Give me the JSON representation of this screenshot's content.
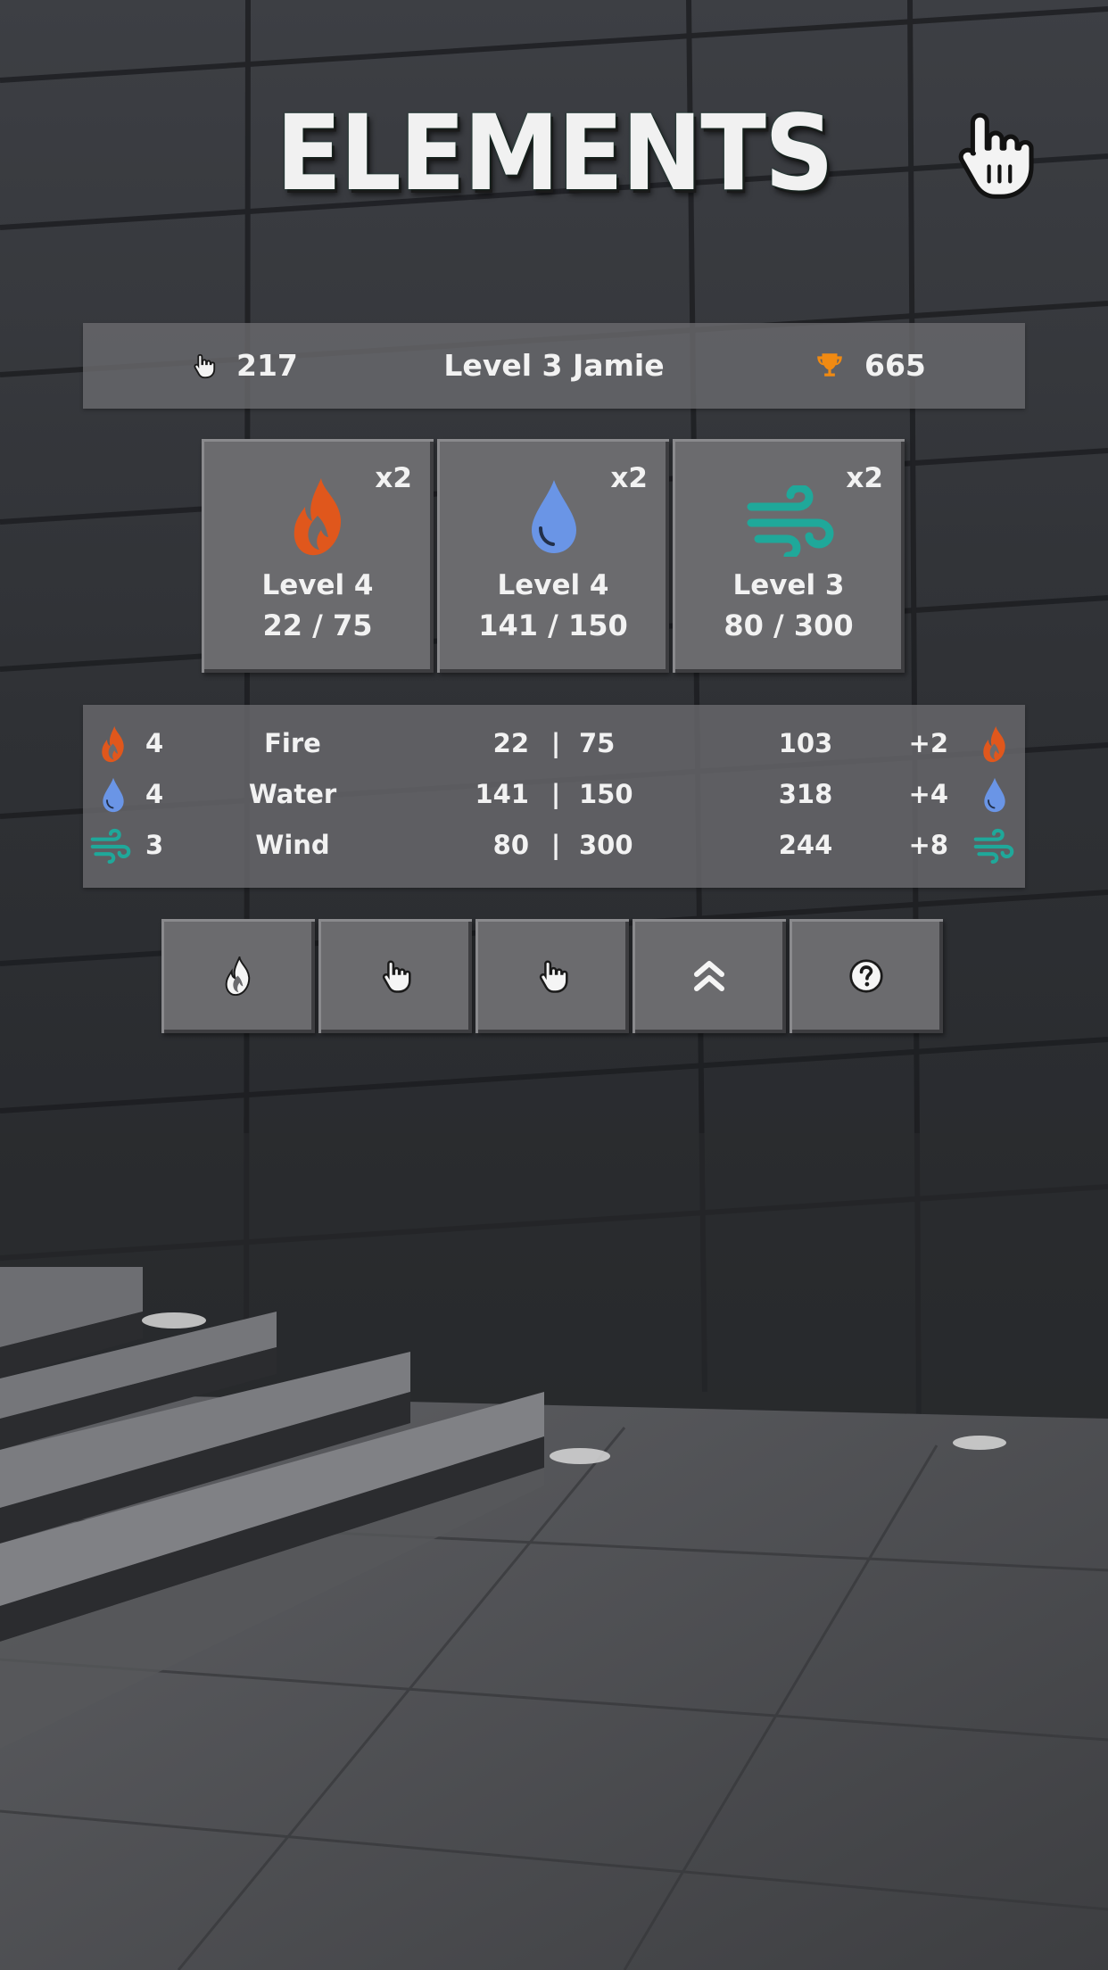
{
  "title": "ELEMENTS",
  "colors": {
    "fire": "#e0571c",
    "water": "#6a95e6",
    "wind": "#1fa89a",
    "trophy": "#f08a12"
  },
  "status": {
    "clicks": "217",
    "player": "Level 3 Jamie",
    "trophies": "665",
    "clicks_icon": "pointer-hand-icon",
    "trophy_icon": "trophy-icon"
  },
  "cards": [
    {
      "element": "fire",
      "icon": "fire-icon",
      "multiplier": "x2",
      "level": "Level 4",
      "progress": "22 / 75"
    },
    {
      "element": "water",
      "icon": "water-drop-icon",
      "multiplier": "x2",
      "level": "Level 4",
      "progress": "141 / 150"
    },
    {
      "element": "wind",
      "icon": "wind-icon",
      "multiplier": "x2",
      "level": "Level 3",
      "progress": "80 / 300"
    }
  ],
  "table": [
    {
      "level": "4",
      "name": "Fire",
      "current": "22",
      "separator": "|",
      "max": "75",
      "total": "103",
      "bonus": "+2"
    },
    {
      "level": "4",
      "name": "Water",
      "current": "141",
      "separator": "|",
      "max": "150",
      "total": "318",
      "bonus": "+4"
    },
    {
      "level": "3",
      "name": "Wind",
      "current": "80",
      "separator": "|",
      "max": "300",
      "total": "244",
      "bonus": "+8"
    }
  ],
  "buttons": [
    {
      "icon": "flame-icon"
    },
    {
      "icon": "pointer-hand-icon"
    },
    {
      "icon": "pointer-hand-icon"
    },
    {
      "icon": "double-chevron-up-icon"
    },
    {
      "icon": "question-circle-icon"
    }
  ]
}
